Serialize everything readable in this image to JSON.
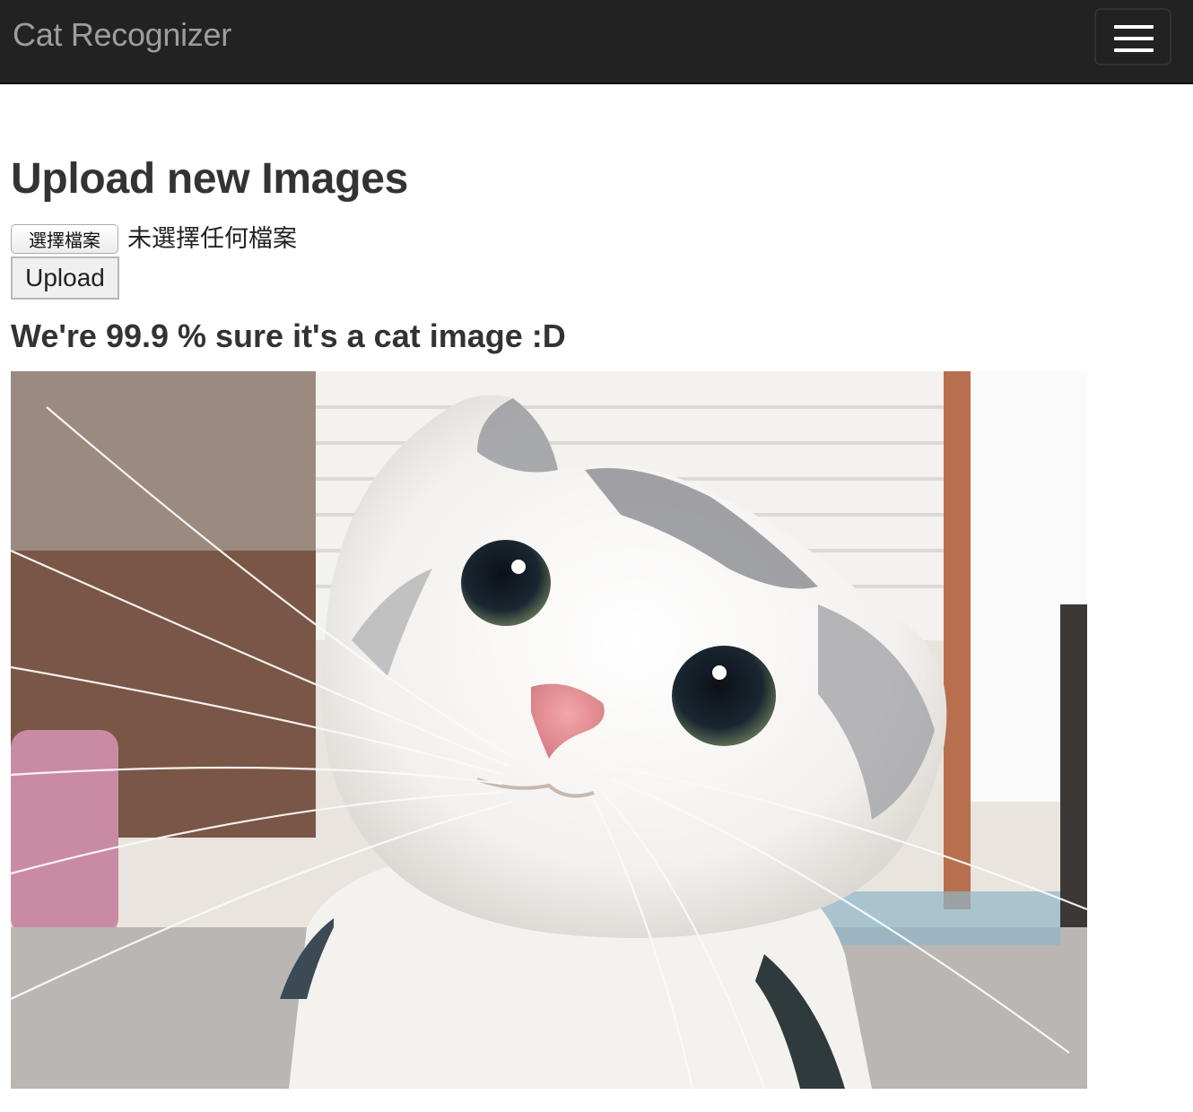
{
  "navbar": {
    "brand": "Cat Recognizer",
    "toggle_icon": "hamburger-menu-icon",
    "background": "#222222"
  },
  "upload": {
    "heading": "Upload new Images",
    "choose_file_label": "選擇檔案",
    "file_status": "未選擇任何檔案",
    "upload_label": "Upload"
  },
  "result": {
    "message": "We're 99.9 % sure it's a cat image :D",
    "confidence_percent": 99.9
  },
  "image": {
    "subject": "cat-photo"
  }
}
